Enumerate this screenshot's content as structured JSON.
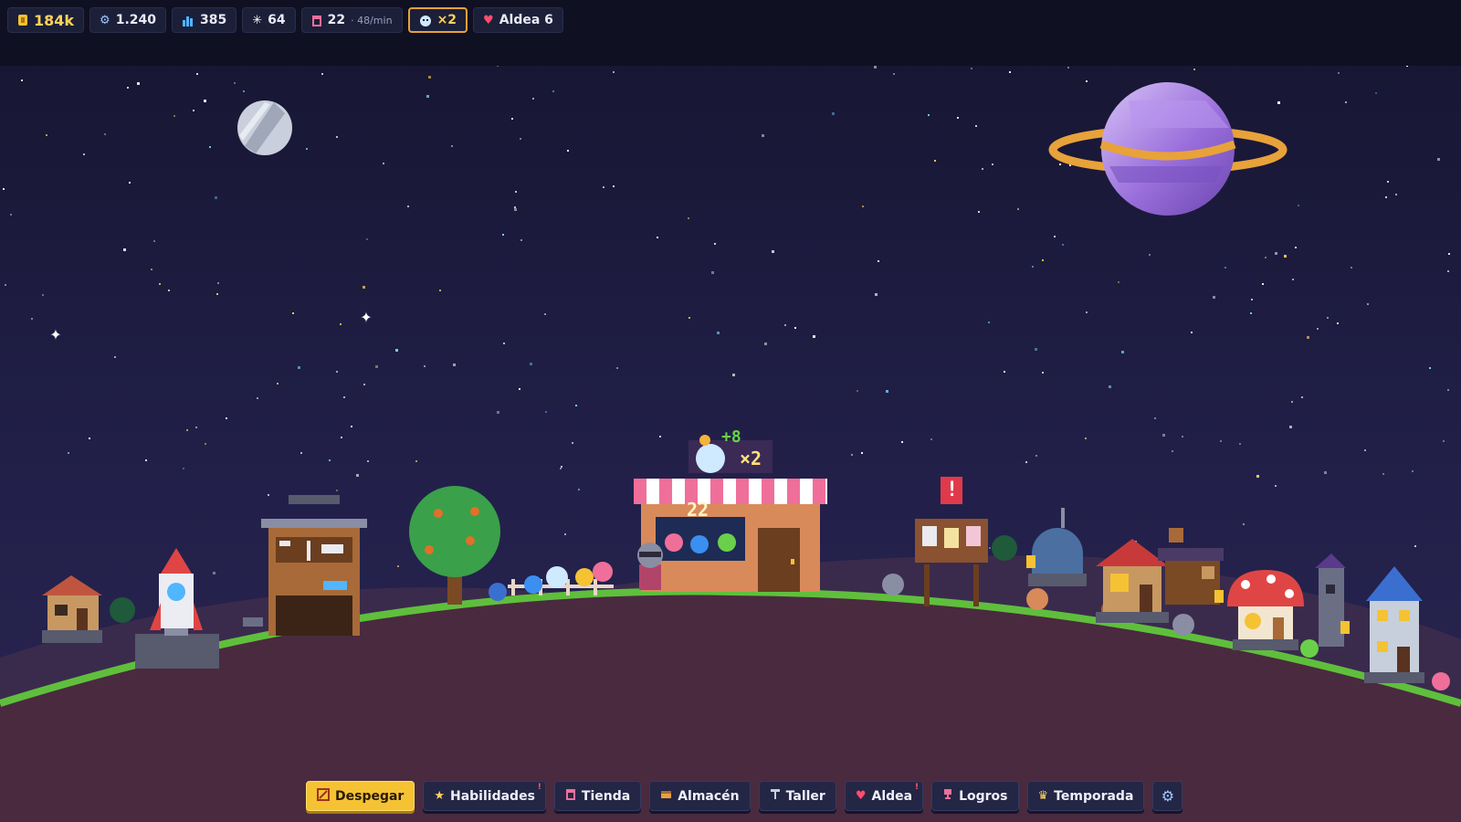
{
  "hud": {
    "coins": "184k",
    "gears": "1.240",
    "crystals": "385",
    "stars": "64",
    "orders": {
      "value": "22",
      "rate": "· 48/min"
    },
    "boost": "×2",
    "village": "Aldea 6"
  },
  "scene": {
    "shop_bonus": "+8",
    "shop_multiplier": "×2",
    "shop_number": "22",
    "alert": "!"
  },
  "nav": [
    {
      "label": "Despegar",
      "icon": "rocket-icon"
    },
    {
      "label": "Habilidades",
      "icon": "star-icon",
      "badge": "!"
    },
    {
      "label": "Tienda",
      "icon": "shop-icon"
    },
    {
      "label": "Almacén",
      "icon": "box-icon"
    },
    {
      "label": "Taller",
      "icon": "hammer-icon"
    },
    {
      "label": "Aldea",
      "icon": "heart-icon",
      "badge": "!"
    },
    {
      "label": "Logros",
      "icon": "trophy-icon"
    },
    {
      "label": "Temporada",
      "icon": "crown-icon"
    }
  ],
  "colors": {
    "sky": "#1c1a3a",
    "hud_bg": "#0f1022",
    "grass": "#5fbf3c",
    "soil": "#4a2a3f",
    "accent": "#f4c233",
    "planet": "#9b73d9",
    "ring": "#e8a23a"
  }
}
